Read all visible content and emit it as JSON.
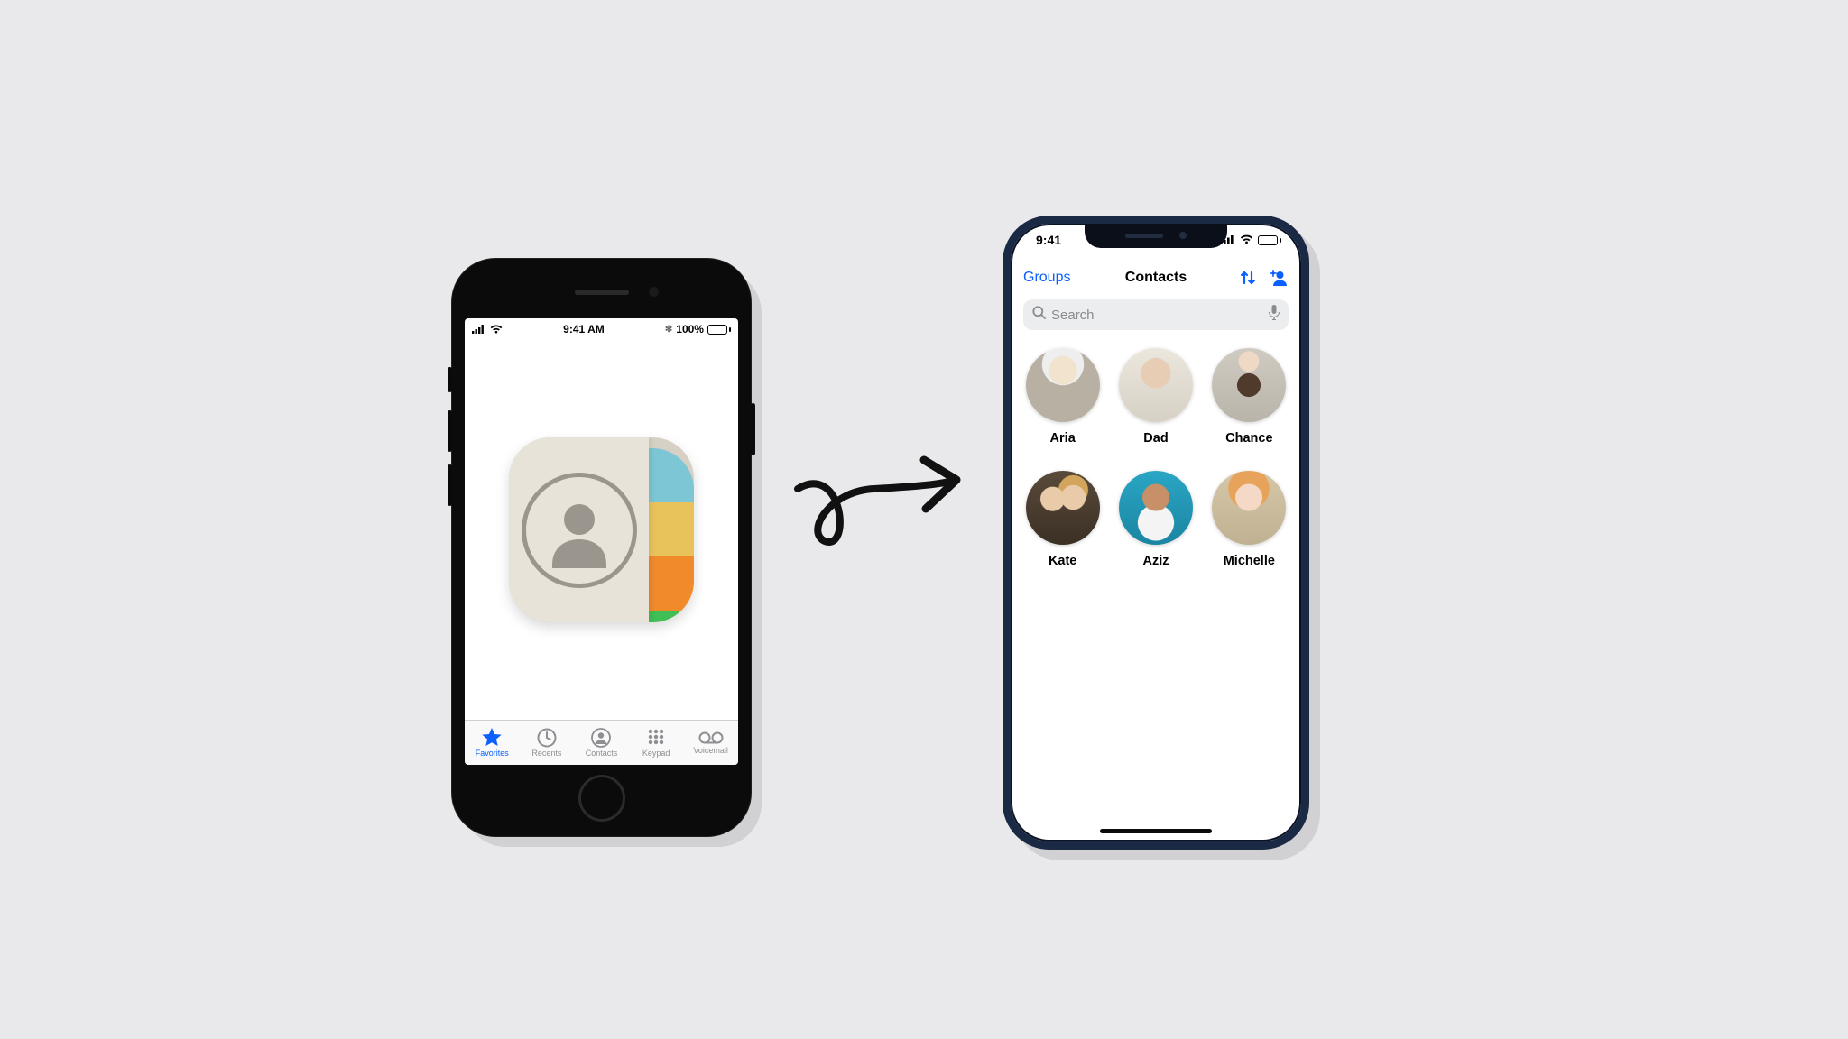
{
  "phoneOld": {
    "status": {
      "time": "9:41 AM",
      "battery_text": "100%",
      "battery_pct": 100
    },
    "tabs": [
      {
        "label": "Favorites",
        "active": true
      },
      {
        "label": "Recents",
        "active": false
      },
      {
        "label": "Contacts",
        "active": false
      },
      {
        "label": "Keypad",
        "active": false
      },
      {
        "label": "Voicemail",
        "active": false
      }
    ]
  },
  "phoneNew": {
    "status": {
      "time": "9:41",
      "battery_pct": 100
    },
    "nav": {
      "groups_label": "Groups",
      "title": "Contacts"
    },
    "search": {
      "placeholder": "Search"
    },
    "contacts": [
      {
        "name": "Aria",
        "avatar": "av-aria"
      },
      {
        "name": "Dad",
        "avatar": "av-dad"
      },
      {
        "name": "Chance",
        "avatar": "av-chance"
      },
      {
        "name": "Kate",
        "avatar": "av-kate"
      },
      {
        "name": "Aziz",
        "avatar": "av-aziz"
      },
      {
        "name": "Michelle",
        "avatar": "av-michelle"
      }
    ]
  }
}
